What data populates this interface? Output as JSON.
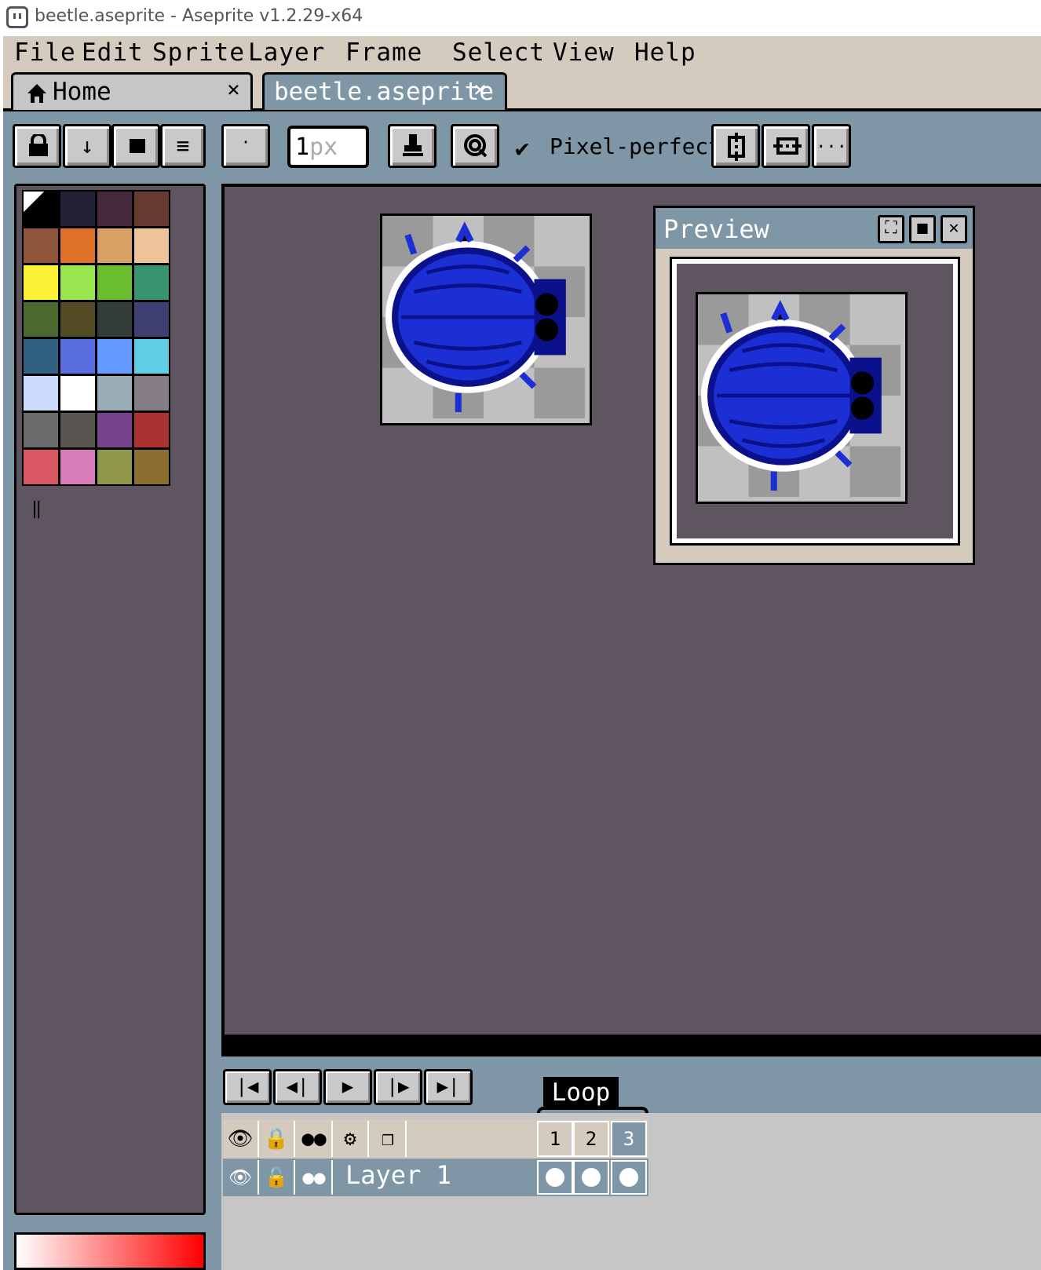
{
  "window": {
    "title": "beetle.aseprite - Aseprite v1.2.29-x64"
  },
  "menu": [
    {
      "label": "File"
    },
    {
      "label": "Edit"
    },
    {
      "label": "Sprite"
    },
    {
      "label": "Layer"
    },
    {
      "label": "Frame"
    },
    {
      "label": "Select"
    },
    {
      "label": "View"
    },
    {
      "label": "Help"
    }
  ],
  "tabs": {
    "home": {
      "label": "Home",
      "close": "×"
    },
    "document": {
      "label": "beetle.aseprite",
      "close": "×"
    }
  },
  "toolbar": {
    "brush_size_value": "1",
    "brush_size_unit": "px",
    "pixel_perfect_label": "Pixel-perfect",
    "pixel_perfect_checked": true,
    "more_label": "..."
  },
  "palette": {
    "colors": [
      "#000000",
      "#222034",
      "#45283c",
      "#663931",
      "#8f563b",
      "#df7126",
      "#d9a066",
      "#eec39a",
      "#fbf236",
      "#99e550",
      "#6abe30",
      "#37946e",
      "#4b692f",
      "#524b24",
      "#323c39",
      "#3f3f74",
      "#306082",
      "#5b6ee1",
      "#639bff",
      "#5fcde4",
      "#cbdbfc",
      "#ffffff",
      "#9badb7",
      "#847e87",
      "#696a6a",
      "#595652",
      "#76428a",
      "#ac3232",
      "#d95763",
      "#d77bba",
      "#8f974a",
      "#8a6f30"
    ]
  },
  "preview": {
    "title": "Preview"
  },
  "timeline": {
    "tag_name": "Loop",
    "layer_name": "Layer 1",
    "frames": [
      "1",
      "2",
      "3"
    ]
  },
  "colors": {
    "frame_blue": "#7e96a6",
    "panel_purple": "#5f5560",
    "beetle_blue": "#1c2fd4",
    "beetle_dark": "#0a118a"
  }
}
